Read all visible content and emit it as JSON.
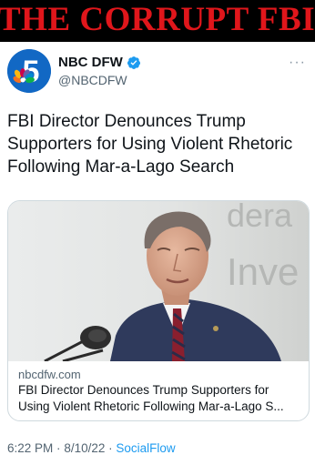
{
  "banner": {
    "text": "THE CORRUPT FBI"
  },
  "account": {
    "name": "NBC DFW",
    "handle": "@NBCDFW",
    "avatar_icon": "nbc-5-logo-icon",
    "verified_icon": "verified-badge-icon",
    "more_icon": "more-options-icon"
  },
  "tweet": {
    "text": "FBI Director Denounces Trump Supporters for Using Violent Rhetoric Following Mar-a-Lago Search"
  },
  "card": {
    "image_caption_letters": [
      "dera",
      "Inve"
    ],
    "domain": "nbcdfw.com",
    "title": "FBI Director Denounces Trump Supporters for Using Violent Rhetoric Following Mar-a-Lago S..."
  },
  "meta": {
    "time": "6:22 PM",
    "date": "8/10/22",
    "separator": "·",
    "source": "SocialFlow"
  },
  "colors": {
    "banner_bg": "#000000",
    "banner_text": "#e0161b",
    "link_blue": "#1d9bf0",
    "secondary_text": "#536471",
    "brand_blue": "#1268c4"
  }
}
